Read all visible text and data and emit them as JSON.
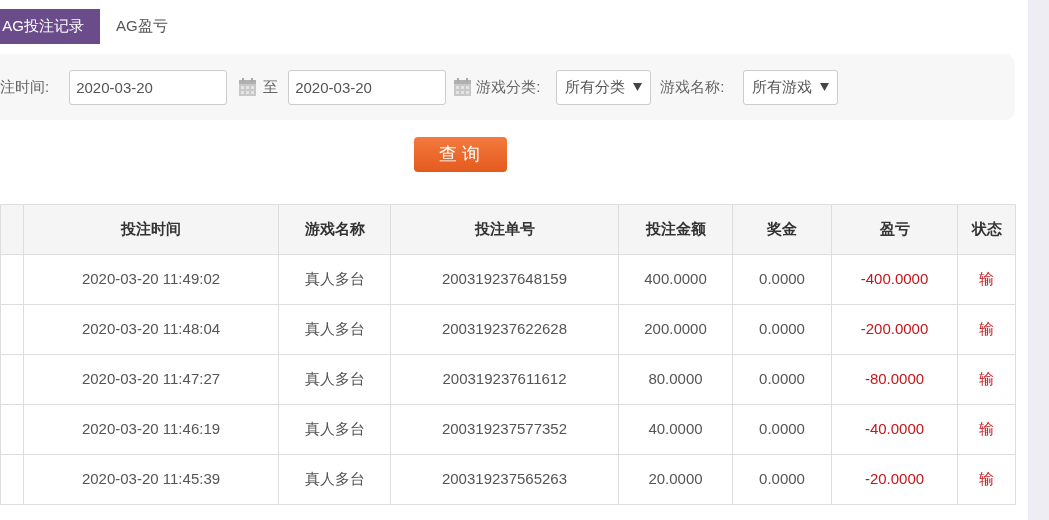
{
  "tabs": [
    {
      "label": "AG投注记录",
      "selected": true
    },
    {
      "label": "AG盈亏",
      "selected": false
    }
  ],
  "filters": {
    "time_label": "注时间:",
    "start_date": "2020-03-20",
    "separator": "至",
    "end_date": "2020-03-20",
    "category_label": "游戏分类:",
    "category_value": "所有分类",
    "game_label": "游戏名称:",
    "game_value": "所有游戏"
  },
  "query_button": "查 询",
  "table": {
    "columns": [
      "投注时间",
      "游戏名称",
      "投注单号",
      "投注金额",
      "奖金",
      "盈亏",
      "状态"
    ],
    "rows": [
      [
        "2020-03-20 11:49:02",
        "真人多台",
        "200319237648159",
        "400.0000",
        "0.0000",
        "-400.0000",
        "输"
      ],
      [
        "2020-03-20 11:48:04",
        "真人多台",
        "200319237622628",
        "200.0000",
        "0.0000",
        "-200.0000",
        "输"
      ],
      [
        "2020-03-20 11:47:27",
        "真人多台",
        "200319237611612",
        "80.0000",
        "0.0000",
        "-80.0000",
        "输"
      ],
      [
        "2020-03-20 11:46:19",
        "真人多台",
        "200319237577352",
        "40.0000",
        "0.0000",
        "-40.0000",
        "输"
      ],
      [
        "2020-03-20 11:45:39",
        "真人多台",
        "200319237565263",
        "20.0000",
        "0.0000",
        "-20.0000",
        "输"
      ]
    ]
  }
}
